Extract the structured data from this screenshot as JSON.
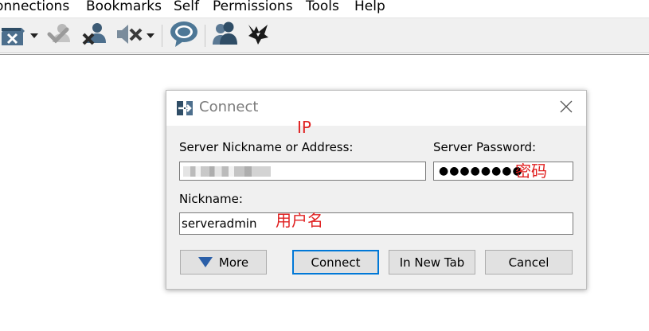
{
  "menubar": {
    "items": [
      "onnections",
      "Bookmarks",
      "Self",
      "Permissions",
      "Tools",
      "Help"
    ]
  },
  "toolbar": {
    "icons": [
      "disconnect-icon",
      "register-user-icon",
      "mute-self-icon",
      "deafen-self-icon",
      "chat-bubble-icon",
      "users-icon",
      "mumble-wolf-icon"
    ]
  },
  "dialog": {
    "title": "Connect",
    "address_label": "Server Nickname or Address:",
    "address_value": "",
    "password_label": "Server Password:",
    "password_dots": "●●●●●●●●",
    "nickname_label": "Nickname:",
    "nickname_value": "serveradmin",
    "buttons": {
      "more": "More",
      "connect": "Connect",
      "new_tab": "In New Tab",
      "cancel": "Cancel"
    }
  },
  "annotations": {
    "ip": "IP",
    "password": "密码",
    "username": "用户名"
  },
  "colors": {
    "annotation": "#e02020",
    "accent": "#0078d7"
  }
}
